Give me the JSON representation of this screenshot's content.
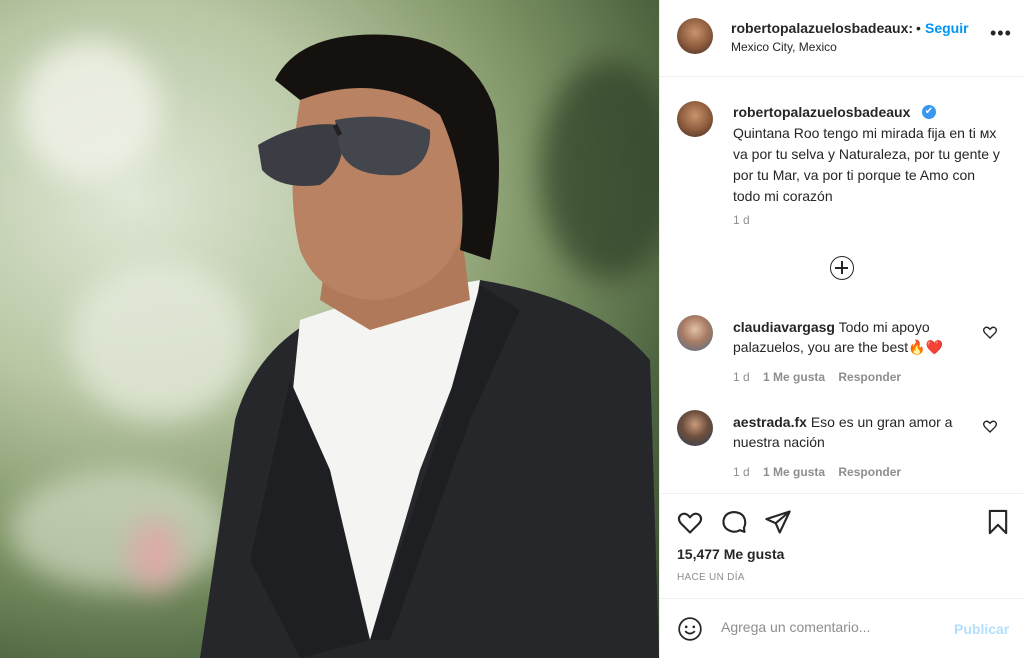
{
  "post": {
    "author": "robertopalazuelosbadeaux",
    "author_truncated": "robertopalazuelosbadeaux:",
    "separator": "•",
    "follow_label": "Seguir",
    "location": "Mexico City, Mexico",
    "more_label": "•••"
  },
  "caption": {
    "username": "robertopalazuelosbadeaux",
    "verified_icon": "✔",
    "text": "Quintana Roo tengo mi mirada fija en ti ᴍx va por tu selva y Naturaleza, por tu gente y por tu Mar, va por ti porque te Amo con todo mi corazón",
    "time": "1 d"
  },
  "comments": [
    {
      "username": "claudiavargasg",
      "text": "Todo mi apoyo palazuelos, you are the best🔥❤️",
      "time": "1 d",
      "likes": "1 Me gusta",
      "reply": "Responder"
    },
    {
      "username": "aestrada.fx",
      "text": "Eso es un gran amor a nuestra nación",
      "time": "1 d",
      "likes": "1 Me gusta",
      "reply": "Responder"
    }
  ],
  "stats": {
    "likes": "15,477 Me gusta",
    "ago": "HACE UN DÍA"
  },
  "add_comment": {
    "placeholder": "Agrega un comentario...",
    "publish_label": "Publicar"
  },
  "icons": [
    "more-icon",
    "verified-icon",
    "load-more-icon",
    "heart-icon",
    "comment-icon",
    "share-icon",
    "bookmark-icon",
    "emoji-icon"
  ],
  "colors": {
    "link": "#0095f6",
    "publish_disabled": "#b2dffc",
    "verified": "#3897f0"
  }
}
